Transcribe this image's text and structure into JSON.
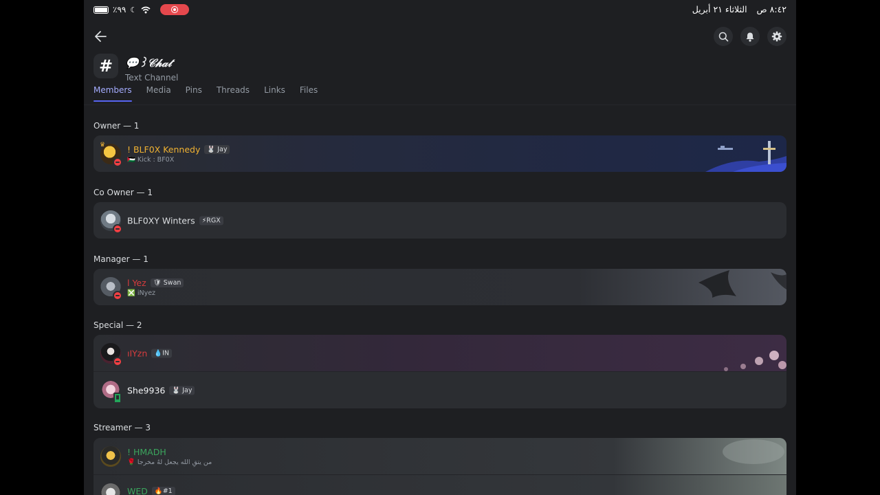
{
  "status_bar": {
    "battery": "٪٩٩",
    "time": "٨:٤٢ ص",
    "date": "الثلاثاء ٢١ أبريل"
  },
  "channel": {
    "title": "💬꒱𝒞𝒽𝒶𝓉",
    "type": "Text Channel",
    "hash": "#"
  },
  "icons": {
    "back": "arrow-left-icon",
    "search": "search-icon",
    "notifications": "bell-icon",
    "settings": "gear-icon"
  },
  "tabs": [
    {
      "label": "Members",
      "active": true
    },
    {
      "label": "Media"
    },
    {
      "label": "Pins"
    },
    {
      "label": "Threads"
    },
    {
      "label": "Links"
    },
    {
      "label": "Files"
    }
  ],
  "sections": [
    {
      "title": "Owner — 1",
      "members": [
        {
          "name": "! BLF0X Kennedy",
          "tag": "🐰 Jay",
          "sub": "🇵🇸 Kick : BF0X",
          "status": "dnd",
          "name_color": "#f0b232"
        }
      ]
    },
    {
      "title": "Co Owner — 1",
      "members": [
        {
          "name": "BLF0XY Winters",
          "tag": "⚡RGX",
          "status": "dnd",
          "name_color": "#dbdee1"
        }
      ]
    },
    {
      "title": "Manager — 1",
      "members": [
        {
          "name": "ا Yez",
          "tag": "🛡 Swan",
          "sub": "❎ iNyez",
          "status": "dnd",
          "name_color": "#d83c3e"
        }
      ]
    },
    {
      "title": "Special — 2",
      "members": [
        {
          "name": "ıIYzn",
          "tag": "💧IN",
          "status": "dnd",
          "name_color": "#d83c3e"
        },
        {
          "name": "She9936",
          "tag": "🐰 Jay",
          "status": "mobile",
          "name_color": "#f2f3f5"
        }
      ]
    },
    {
      "title": "Streamer — 3",
      "members": [
        {
          "name": "! HMADH",
          "sub": "🌹 من يتقِ الله يجعل لهُ مخرجا",
          "name_color": "#3ba55d"
        },
        {
          "name": "WED",
          "tag": "🔥#1",
          "name_color": "#3ba55d"
        }
      ]
    }
  ]
}
